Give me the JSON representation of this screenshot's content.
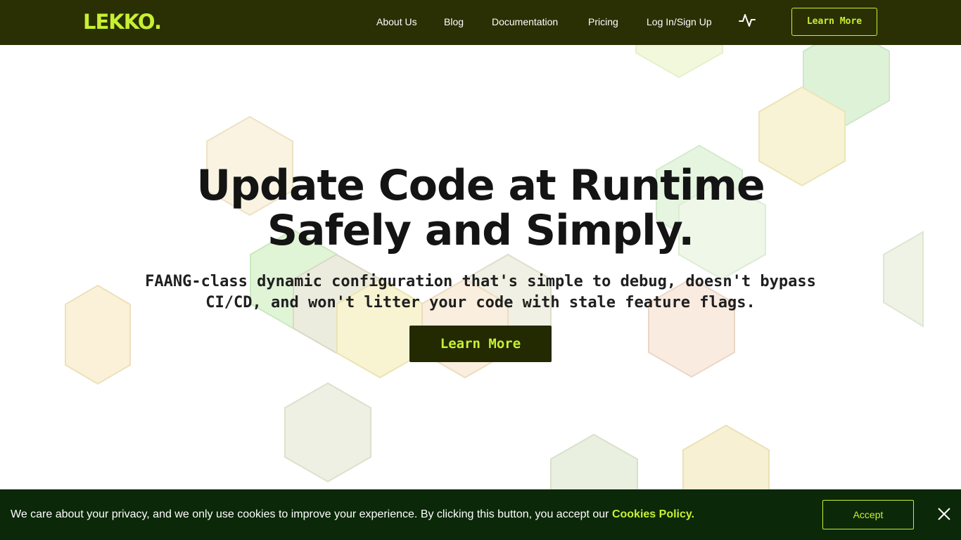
{
  "header": {
    "logo": "LEKKO.",
    "nav": [
      {
        "label": "About Us"
      },
      {
        "label": "Blog"
      },
      {
        "label": "Documentation"
      },
      {
        "label": "Pricing"
      },
      {
        "label": "Log In/Sign Up"
      }
    ],
    "status_icon": "activity-pulse-icon",
    "cta_label": "Learn More"
  },
  "hero": {
    "title": "Update Code at Runtime\nSafely and Simply.",
    "subtitle": "FAANG-class dynamic configuration that's simple to debug, doesn't bypass CI/CD, and won't litter your code with stale feature flags.",
    "cta_label": "Learn More"
  },
  "cookie_banner": {
    "text": "We care about your privacy, and we only use cookies to improve your experience. By clicking this button, you accept our ",
    "link_label": "Cookies Policy.",
    "accept_label": "Accept",
    "close_icon": "close-icon"
  },
  "colors": {
    "brand_dark": "#2a3003",
    "brand_accent": "#c8f032",
    "cookie_bg": "#0b2808"
  }
}
